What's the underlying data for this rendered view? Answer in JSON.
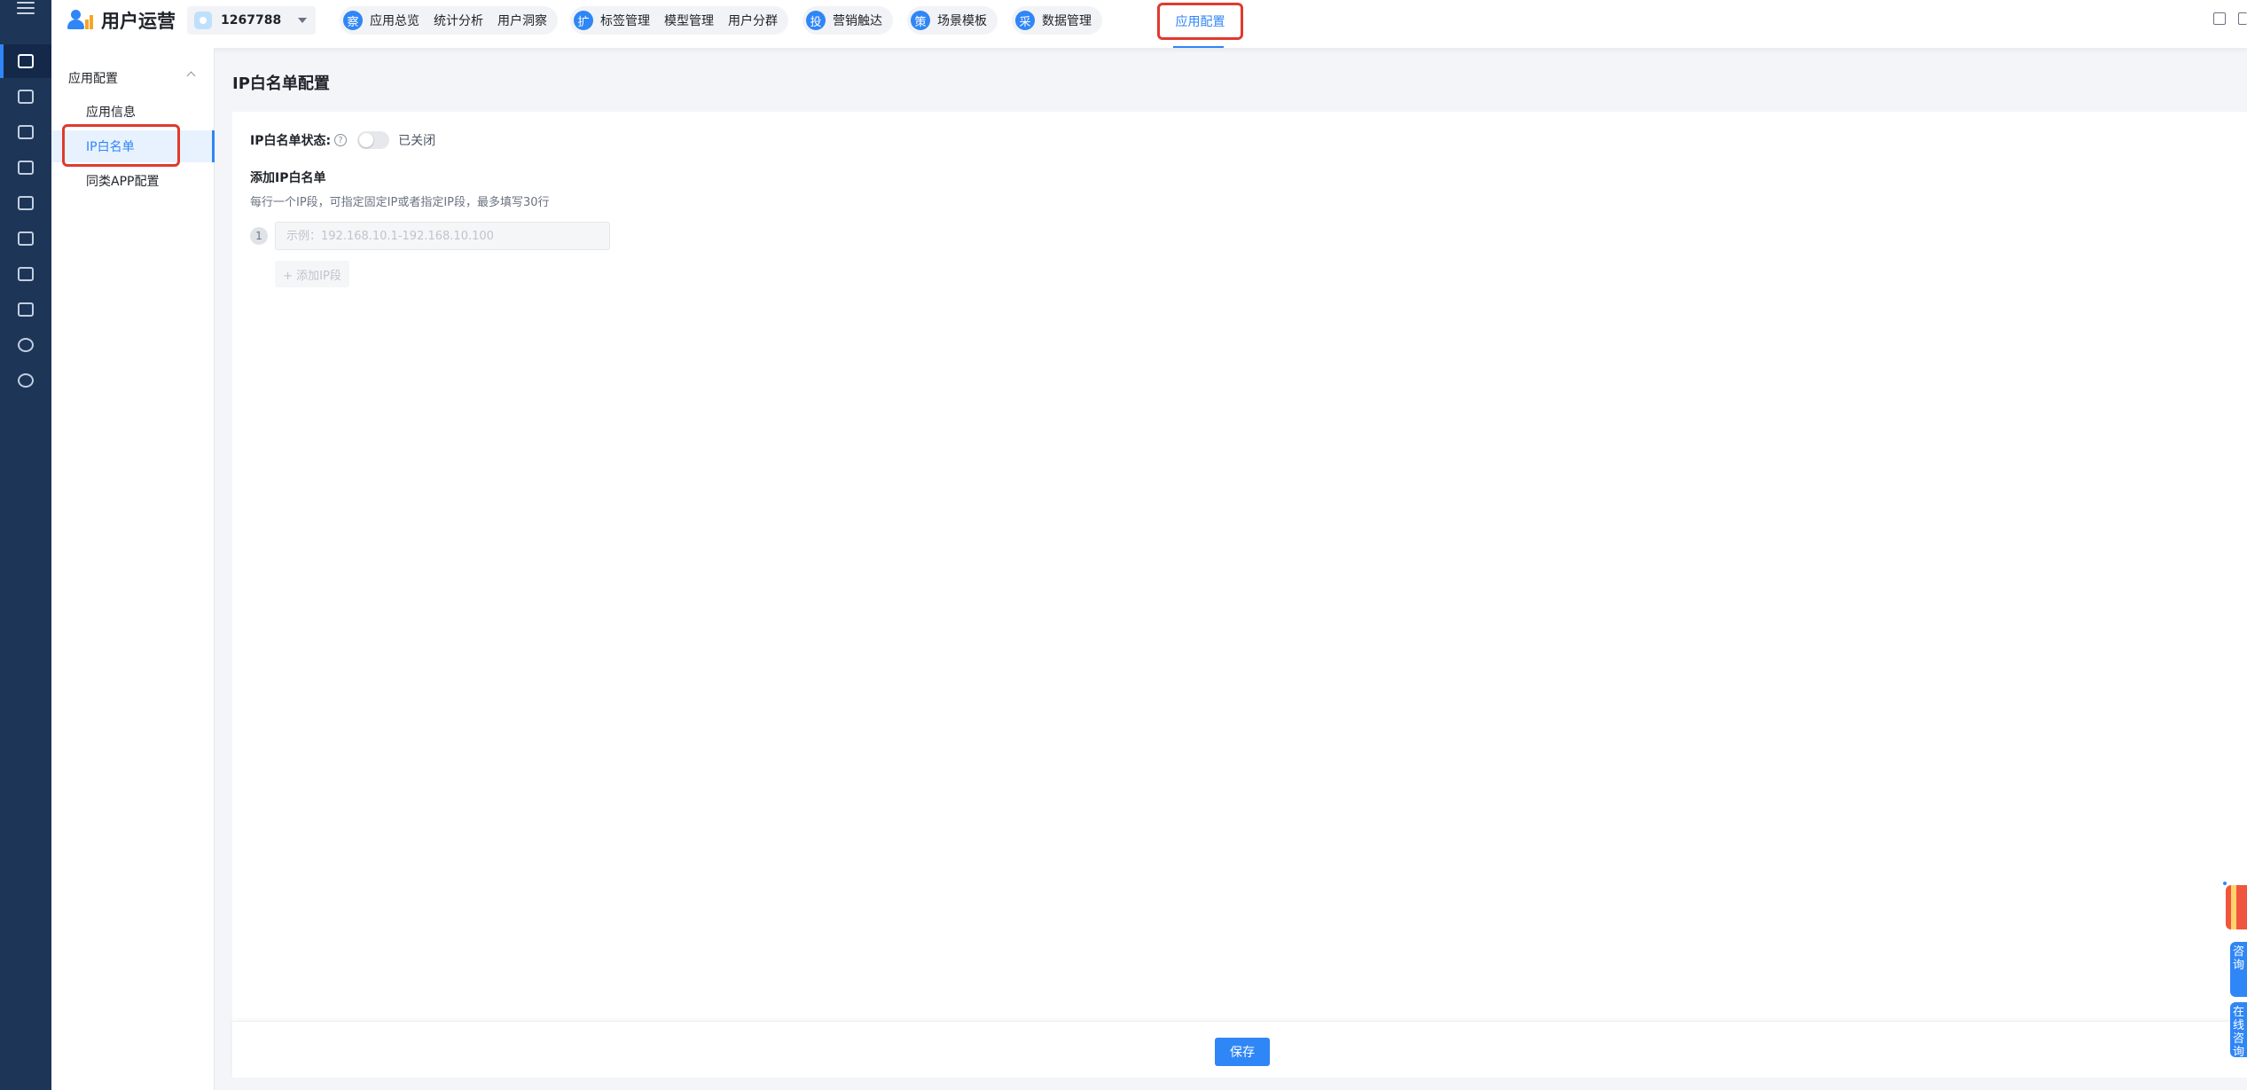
{
  "app": {
    "title": "用户运营",
    "app_id": "1267788"
  },
  "nav_groups": [
    {
      "badge": "察",
      "items": [
        "应用总览",
        "统计分析",
        "用户洞察"
      ]
    },
    {
      "badge": "扩",
      "items": [
        "标签管理",
        "模型管理",
        "用户分群"
      ]
    },
    {
      "badge": "投",
      "items": [
        "营销触达"
      ]
    },
    {
      "badge": "策",
      "items": [
        "场景模板"
      ]
    },
    {
      "badge": "采",
      "items": [
        "数据管理"
      ]
    }
  ],
  "nav_active": "应用配置",
  "subnav": {
    "group": "应用配置",
    "items": [
      "应用信息",
      "IP白名单",
      "同类APP配置"
    ],
    "active_index": 1
  },
  "page": {
    "title": "IP白名单配置",
    "status_label": "IP白名单状态:",
    "status_help": "?",
    "toggle_state": "已关闭",
    "toggle_on": false,
    "section_title": "添加IP白名单",
    "section_desc": "每行一个IP段，可指定固定IP或者指定IP段，最多填写30行",
    "ip_rows": [
      {
        "index": "1",
        "value": "",
        "placeholder": "示例：192.168.10.1-192.168.10.100"
      }
    ],
    "add_label": "+ 添加IP段",
    "save_label": "保存"
  },
  "floating": {
    "tab1": "咨询",
    "tab2": "在线咨询"
  },
  "colors": {
    "accent": "#2f86f6",
    "rail": "#1d3557",
    "highlight": "#e03a2e"
  },
  "icons": [
    "menu-icon",
    "users-icon",
    "chart-icon",
    "tag-icon",
    "bag-icon",
    "image-icon",
    "person-gear-icon",
    "doc-icon",
    "cube-icon",
    "globe-icon",
    "search-target-icon"
  ]
}
